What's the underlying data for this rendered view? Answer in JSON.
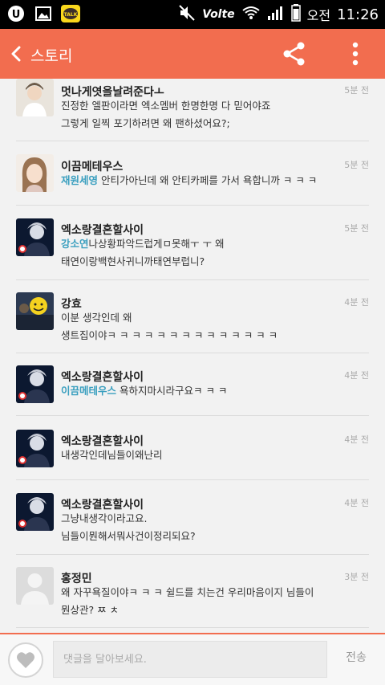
{
  "status_bar": {
    "ampm": "오전",
    "time": "11:26",
    "volte": "Volte",
    "kakao_label": "TALK",
    "icons": [
      "u-plus-icon",
      "gallery-icon",
      "kakaotalk-icon",
      "mute-icon",
      "volte-icon",
      "wifi-icon",
      "signal-icon",
      "battery-icon"
    ]
  },
  "app_bar": {
    "title": "스토리",
    "accent_color": "#f26d4f"
  },
  "comments": [
    {
      "name": "멋나게엿을날려준다ㅗ",
      "time": "5분 전",
      "lines": [
        "진정한 엘판이라면 엑소멤버 한명한명 다 믿어야죠",
        "그렇게 일찍 포기하려면 왜 팬하셨어요?;"
      ],
      "mention": "",
      "after_mention": ""
    },
    {
      "name": "이끔메테우스",
      "time": "5분 전",
      "lines": [],
      "mention": "재원세영",
      "after_mention": " 안티가아닌데 왜 안티카페를 가서 욕합니까 ㅋ ㅋ ㅋ"
    },
    {
      "name": "엑소랑결혼할사이",
      "time": "5분 전",
      "lines": [
        "태연이랑백현사귀니까태연부럽니?"
      ],
      "mention": "강소연",
      "after_mention": "나상황파악드럽게ㅁ못해ㅜ ㅜ 왜"
    },
    {
      "name": "강효",
      "time": "4분 전",
      "lines": [
        "이분 생각인데 왜",
        "생트집이야ㅋ ㅋ ㅋ ㅋ ㅋ ㅋ ㅋ ㅋ ㅋ ㅋ ㅋ ㅋ ㅋ ㅋ"
      ],
      "mention": "",
      "after_mention": ""
    },
    {
      "name": "엑소랑결혼할사이",
      "time": "4분 전",
      "lines": [],
      "mention": "이끔메테우스",
      "after_mention": " 욕하지마시라구요ㅋ ㅋ ㅋ"
    },
    {
      "name": "엑소랑결혼할사이",
      "time": "4분 전",
      "lines": [
        "내생각인데님들이왜난리"
      ],
      "mention": "",
      "after_mention": ""
    },
    {
      "name": "엑소랑결혼할사이",
      "time": "4분 전",
      "lines": [
        "그냥내생각이라고요.",
        "님들이뭔해서뭐사건이정리되요?"
      ],
      "mention": "",
      "after_mention": ""
    },
    {
      "name": "홍정민",
      "time": "3분 전",
      "lines": [
        "왜 자꾸욕질이야ㅋ ㅋ ㅋ 쉴드를 치는건 우리마음이지 님들이",
        "뭔상관? ㅉ ㅊ"
      ],
      "mention": "",
      "after_mention": ""
    }
  ],
  "bottom_bar": {
    "placeholder": "댓글을 달아보세요.",
    "send_label": "전송"
  }
}
